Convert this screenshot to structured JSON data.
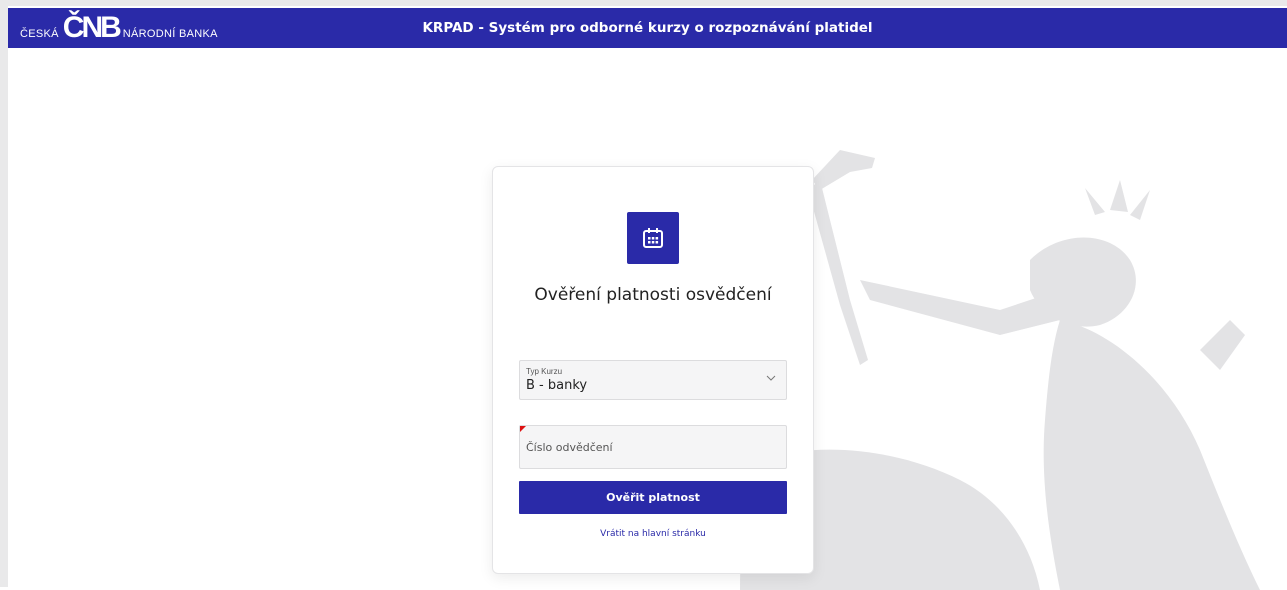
{
  "header": {
    "logo_left": "ČESKÁ",
    "logo_mark": "ČNB",
    "logo_right": "NÁRODNÍ BANKA",
    "title": "KRPAD - Systém pro odborné kurzy o rozpoznávání platidel"
  },
  "card": {
    "icon": "calendar-icon",
    "title": "Ověření platnosti osvědčení",
    "course_select": {
      "label": "Typ Kurzu",
      "value": "B - banky"
    },
    "certificate_input": {
      "placeholder": "Číslo odvědčení",
      "value": ""
    },
    "submit_label": "Ověřit platnost",
    "back_link": "Vrátit na hlavní stránku"
  },
  "colors": {
    "brand": "#2a2aa8",
    "required_marker": "#dd1111",
    "background_art": "#e6e6e8"
  }
}
